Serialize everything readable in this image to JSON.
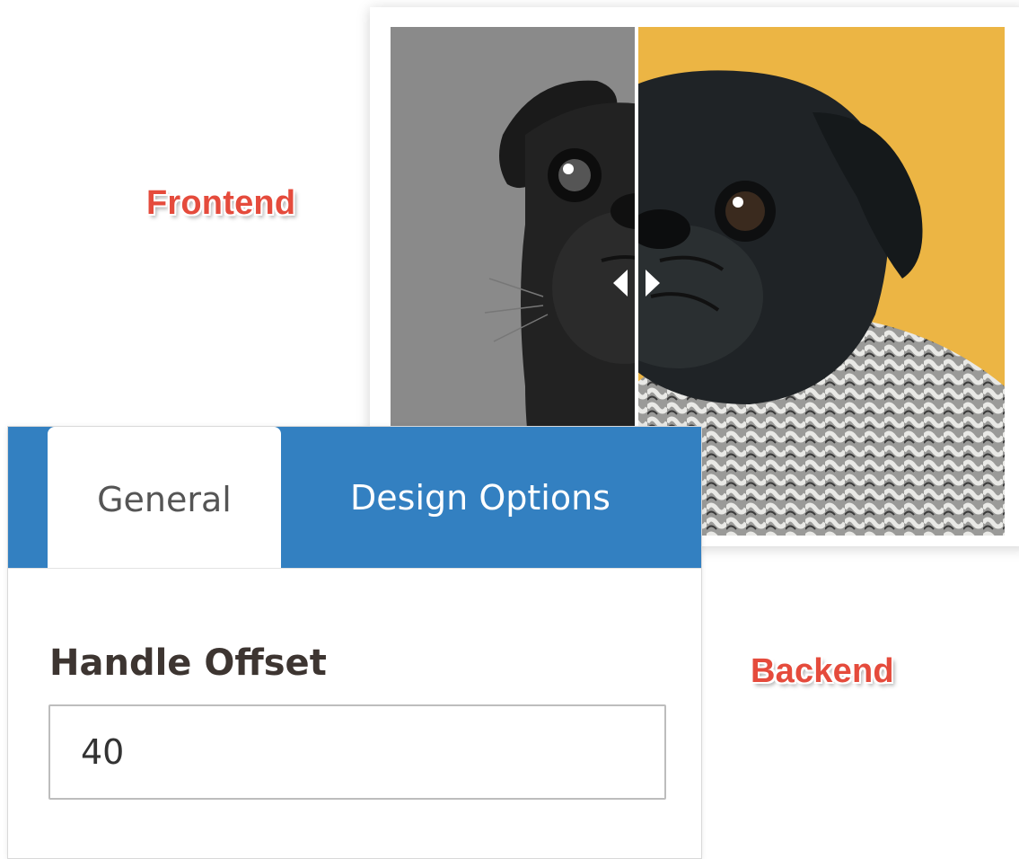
{
  "callouts": {
    "frontend": "Frontend",
    "backend": "Backend"
  },
  "image_comparison": {
    "handle_offset_percent": 40,
    "before_background": "#8a8a8a",
    "after_background": "#ecb544",
    "handle_icon": "left-right-arrows-icon"
  },
  "tabs": [
    {
      "label": "General",
      "active": true
    },
    {
      "label": "Design Options",
      "active": false
    }
  ],
  "form": {
    "handle_offset": {
      "label": "Handle Offset",
      "value": "40"
    }
  },
  "colors": {
    "tab_bar": "#3380c1",
    "callout_text": "#e54b3c"
  }
}
